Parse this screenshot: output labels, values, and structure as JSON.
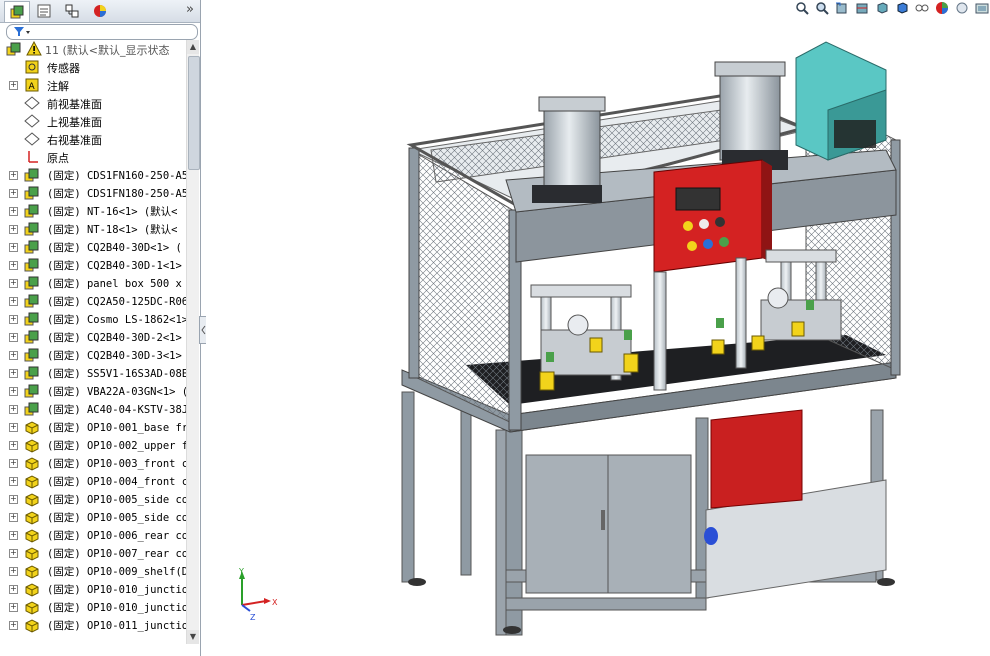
{
  "panel_tabs": [
    {
      "name": "feature-manager-tab",
      "icon": "feature-tree-icon"
    },
    {
      "name": "property-manager-tab",
      "icon": "property-icon"
    },
    {
      "name": "configuration-manager-tab",
      "icon": "configuration-icon"
    },
    {
      "name": "display-manager-tab",
      "icon": "appearance-icon"
    }
  ],
  "expand_panel_label": "»",
  "filter_icon": "filter-icon",
  "tree": {
    "root": {
      "label": "11  (默认<默认_显示状态",
      "icon": "assembly-warning-icon"
    },
    "items": [
      {
        "label": "传感器",
        "icon": "sensor-icon",
        "expandable": false,
        "cjk": true
      },
      {
        "label": "注解",
        "icon": "annotation-icon",
        "expandable": true,
        "cjk": true
      },
      {
        "label": "前视基准面",
        "icon": "plane-icon",
        "expandable": false,
        "cjk": true
      },
      {
        "label": "上视基准面",
        "icon": "plane-icon",
        "expandable": false,
        "cjk": true
      },
      {
        "label": "右视基准面",
        "icon": "plane-icon",
        "expandable": false,
        "cjk": true
      },
      {
        "label": "原点",
        "icon": "origin-icon",
        "expandable": false,
        "cjk": true
      },
      {
        "label": "(固定) CDS1FN160-250-A5",
        "icon": "subassembly-icon",
        "expandable": true
      },
      {
        "label": "(固定) CDS1FN180-250-A5",
        "icon": "subassembly-icon",
        "expandable": true
      },
      {
        "label": "(固定) NT-16<1> (默认<",
        "icon": "subassembly-icon",
        "expandable": true
      },
      {
        "label": "(固定) NT-18<1> (默认<",
        "icon": "subassembly-icon",
        "expandable": true
      },
      {
        "label": "(固定) CQ2B40-30D<1> (",
        "icon": "subassembly-icon",
        "expandable": true
      },
      {
        "label": "(固定) CQ2B40-30D-1<1>",
        "icon": "subassembly-icon",
        "expandable": true
      },
      {
        "label": "(固定) panel box 500 x",
        "icon": "subassembly-icon",
        "expandable": true
      },
      {
        "label": "(固定) CQ2A50-125DC-R06",
        "icon": "subassembly-icon",
        "expandable": true
      },
      {
        "label": "(固定) Cosmo LS-1862<1>",
        "icon": "subassembly-icon",
        "expandable": true
      },
      {
        "label": "(固定) CQ2B40-30D-2<1>",
        "icon": "subassembly-icon",
        "expandable": true
      },
      {
        "label": "(固定) CQ2B40-30D-3<1>",
        "icon": "subassembly-icon",
        "expandable": true
      },
      {
        "label": "(固定) SS5V1-16S3AD-08E",
        "icon": "subassembly-icon",
        "expandable": true
      },
      {
        "label": "(固定) VBA22A-03GN<1> (",
        "icon": "subassembly-icon",
        "expandable": true
      },
      {
        "label": "(固定) AC40-04-KSTV-38J",
        "icon": "subassembly-icon",
        "expandable": true
      },
      {
        "label": "(固定) OP10-001_base fr",
        "icon": "part-icon",
        "expandable": true
      },
      {
        "label": "(固定) OP10-002_upper f",
        "icon": "part-icon",
        "expandable": true
      },
      {
        "label": "(固定) OP10-003_front c",
        "icon": "part-icon",
        "expandable": true
      },
      {
        "label": "(固定) OP10-004_front c",
        "icon": "part-icon",
        "expandable": true
      },
      {
        "label": "(固定) OP10-005_side co",
        "icon": "part-icon",
        "expandable": true
      },
      {
        "label": "(固定) OP10-005_side co",
        "icon": "part-icon",
        "expandable": true
      },
      {
        "label": "(固定) OP10-006_rear co",
        "icon": "part-icon",
        "expandable": true
      },
      {
        "label": "(固定) OP10-007_rear co",
        "icon": "part-icon",
        "expandable": true
      },
      {
        "label": "(固定) OP10-009_shelf(D",
        "icon": "part-icon",
        "expandable": true
      },
      {
        "label": "(固定) OP10-010_junctio",
        "icon": "part-icon",
        "expandable": true
      },
      {
        "label": "(固定) OP10-010_junctio",
        "icon": "part-icon",
        "expandable": true
      },
      {
        "label": "(固定) OP10-011_junctio",
        "icon": "part-icon",
        "expandable": true
      }
    ]
  },
  "view_toolbar": [
    "zoom-to-fit-icon",
    "zoom-to-area-icon",
    "previous-view-icon",
    "section-view-icon",
    "view-orientation-icon",
    "display-style-icon",
    "hide-show-items-icon",
    "edit-appearance-icon",
    "apply-scene-icon",
    "view-settings-icon"
  ],
  "triad": {
    "x": "X",
    "y": "Y",
    "z": "Z"
  },
  "colors": {
    "accent_red": "#d42222",
    "frame_gray": "#8f9aa3",
    "cyan_box": "#5ac7c4",
    "yellow_part": "#f2d31b"
  }
}
